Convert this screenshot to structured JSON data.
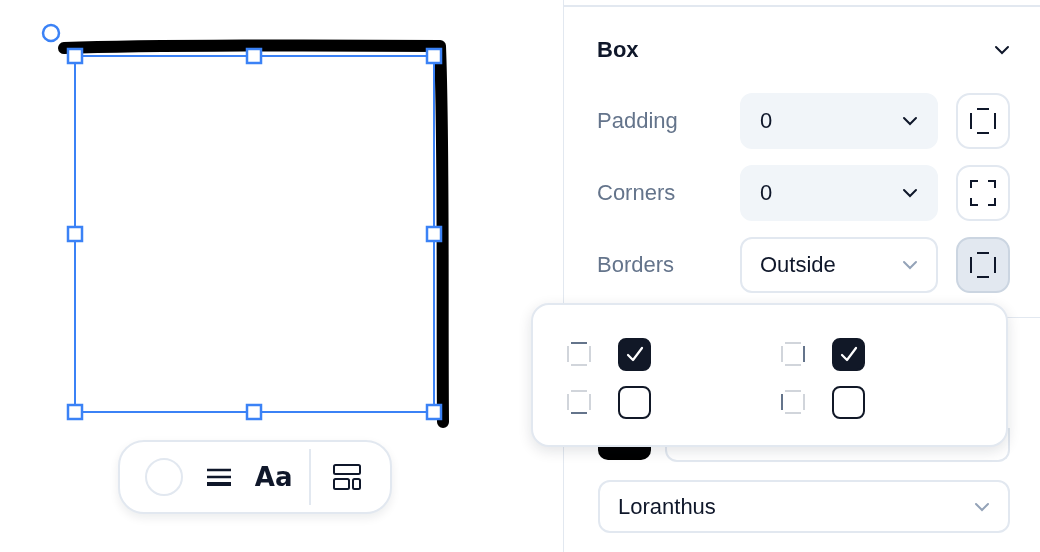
{
  "canvas": {
    "shape": {
      "kind": "rectangle",
      "selected": true
    },
    "toolbar": [
      {
        "kind": "color"
      },
      {
        "kind": "stroke"
      },
      {
        "kind": "text",
        "label": "Aa"
      },
      {
        "kind": "divider"
      },
      {
        "kind": "layout"
      }
    ]
  },
  "panel": {
    "section": {
      "title": "Box",
      "expanded": true,
      "rows": [
        {
          "label": "Padding",
          "value": "0",
          "kind": "filled",
          "active": false
        },
        {
          "label": "Corners",
          "value": "0",
          "kind": "filled",
          "active": false
        },
        {
          "label": "Borders",
          "value": "Outside",
          "kind": "outlined",
          "active": true
        }
      ]
    },
    "font": {
      "value": "Loranthus"
    }
  },
  "borders_popover": {
    "sides": [
      {
        "checked": true
      },
      {
        "checked": true
      },
      {
        "checked": false
      },
      {
        "checked": false
      }
    ]
  }
}
